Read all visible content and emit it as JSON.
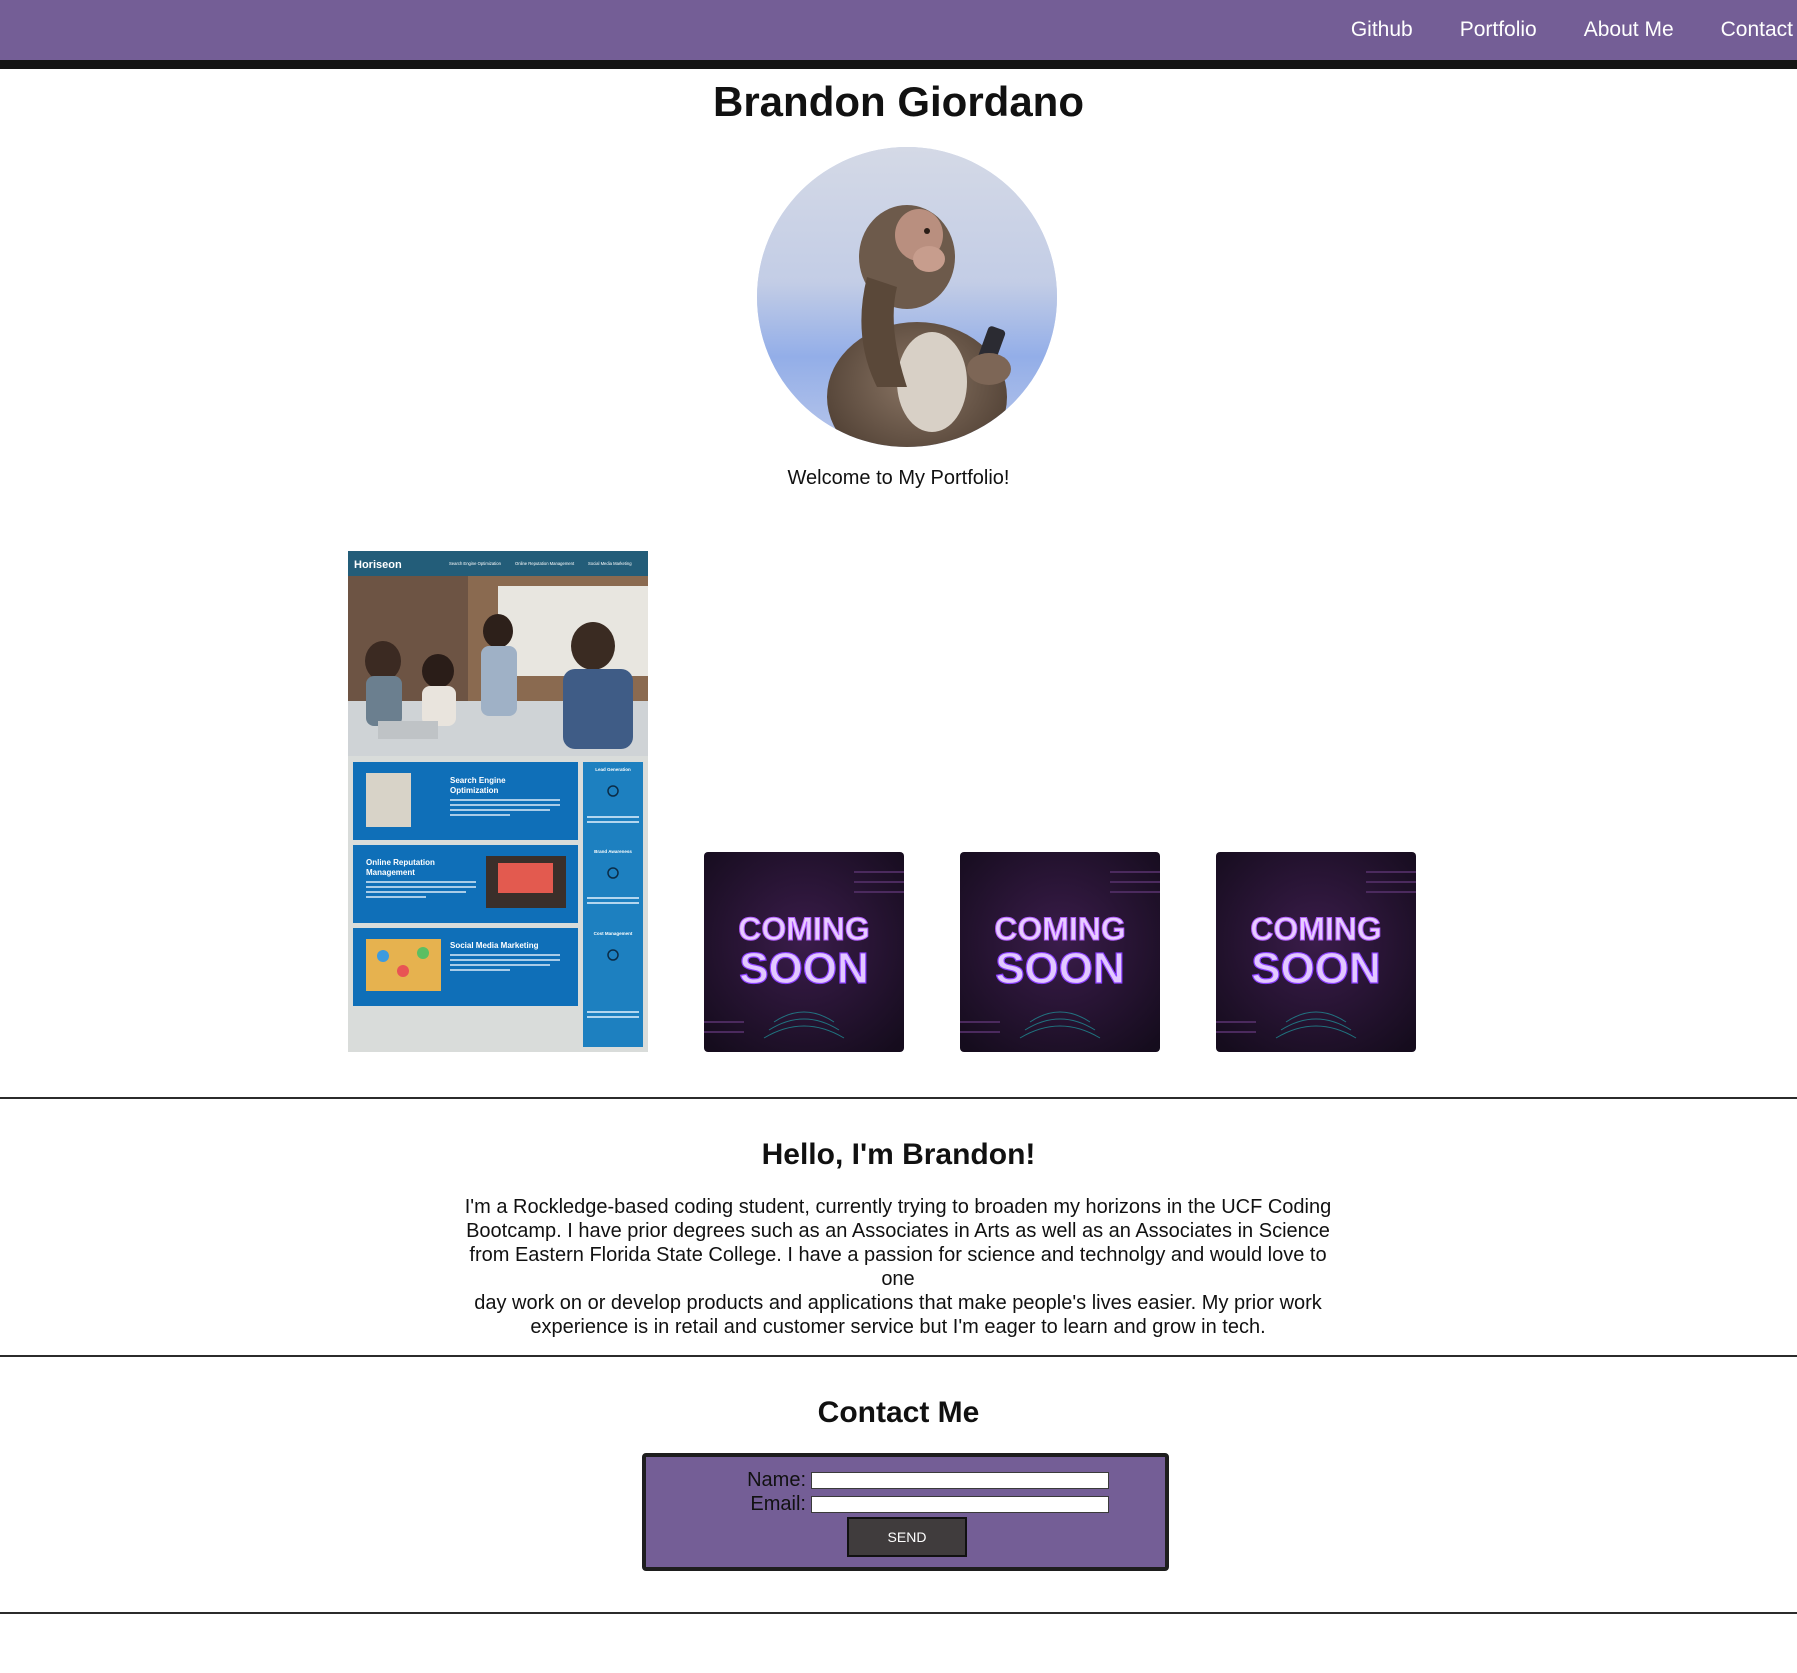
{
  "nav": {
    "links": [
      {
        "label": "Github"
      },
      {
        "label": "Portfolio"
      },
      {
        "label": "About Me"
      },
      {
        "label": "Contact"
      }
    ]
  },
  "header": {
    "name": "Brandon Giordano",
    "welcome": "Welcome to My Portfolio!"
  },
  "portfolio": {
    "featured": {
      "brand": "Horiseon",
      "nav_items": [
        "Search Engine Optimization",
        "Online Reputation Management",
        "Social Media Marketing"
      ],
      "cards": [
        "Search Engine Optimization",
        "Online Reputation Management",
        "Social Media Marketing"
      ],
      "sidebar": [
        "Lead Generation",
        "Brand Awareness",
        "Cost Management"
      ]
    },
    "placeholders": [
      {
        "line1": "COMING",
        "line2": "SOON"
      },
      {
        "line1": "COMING",
        "line2": "SOON"
      },
      {
        "line1": "COMING",
        "line2": "SOON"
      }
    ]
  },
  "about": {
    "heading": "Hello, I'm Brandon!",
    "lines": [
      "I'm a Rockledge-based coding student, currently trying to broaden my horizons in the UCF Coding",
      "Bootcamp. I have prior degrees such as an Associates in Arts as well as an Associates in Science",
      "from Eastern Florida State College. I have a passion for science and technolgy and would love to one",
      "day work on or develop products and applications that make people's lives easier. My prior work",
      "experience is in retail and customer service but I'm eager to learn and grow in tech."
    ]
  },
  "contact": {
    "heading": "Contact Me",
    "name_label": "Name:",
    "email_label": "Email:",
    "name_value": "",
    "email_value": "",
    "send_label": "SEND"
  },
  "colors": {
    "accent": "#745e96",
    "nav_border": "#151515",
    "button": "#403c3d"
  }
}
